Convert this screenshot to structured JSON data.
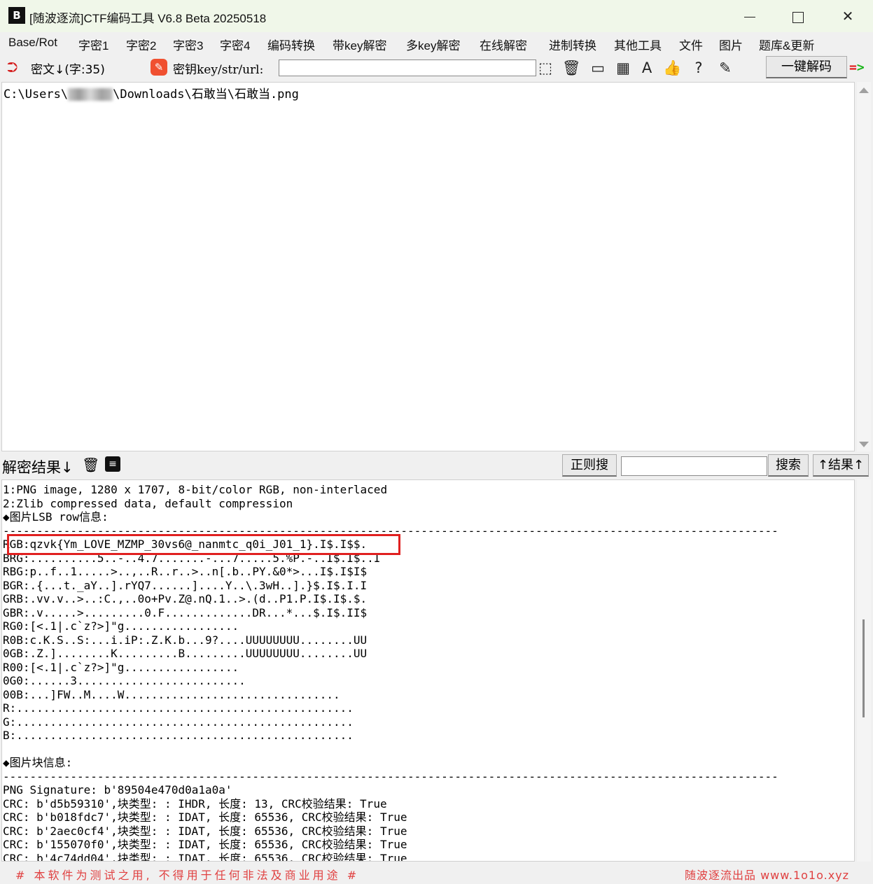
{
  "window": {
    "logo": "B",
    "title": "[随波逐流]CTF编码工具 V6.8 Beta 20250518"
  },
  "menu": [
    "Base/Rot",
    "字密1",
    "字密2",
    "字密3",
    "字密4",
    "编码转换",
    "带key解密",
    "多key解密",
    "在线解密",
    "进制转换",
    "其他工具",
    "文件",
    "图片",
    "题库&更新"
  ],
  "toolbar": {
    "cipher_label": "密文↓(字:35)",
    "key_label": "密钥key/str/url:",
    "key_value": "",
    "decode_button": "一键解码",
    "arrow_left": "=",
    "arrow_right": ">"
  },
  "input": {
    "path_prefix": "C:\\Users\\",
    "path_suffix": "\\Downloads\\石敢当\\石敢当.png"
  },
  "result": {
    "label": "解密结果↓",
    "regex_button": "正则搜",
    "search_value": "",
    "search_button": "搜索",
    "result_up_button": "↑结果↑"
  },
  "output_lines": [
    "1:PNG image, 1280 x 1707, 8-bit/color RGB, non-interlaced",
    "2:Zlib compressed data, default compression",
    "◆图片LSB row信息:",
    "-------------------------------------------------------------------------------------------------------------------",
    "RGB:qzvk{Ym_LOVE_MZMP_30vs6@_nanmtc_q0i_J01_1}.I$.I$$.",
    "BRG:..........5..-..4.7.......-...7.....5.%P.-..I$.I$..I",
    "RBG:p..f..1.....>..,..R..r..>..n[.b..PY.&0*>...I$.I$I$",
    "BGR:.{...t._aY..].rYQ7......]....Y..\\.3wH..].}$.I$.I.I",
    "GRB:.vv.v..>..:C.,..0o+Pv.Z@.nQ.1..>.(d..P1.P.I$.I$.$.",
    "GBR:.v.....>.........0.F.............DR...*...$.I$.II$",
    "RG0:[<.1|.c`z?>]\"g.................",
    "R0B:c.K.S..S:...i.iP:.Z.K.b...9?....UUUUUUUU........UU",
    "0GB:.Z.]........K.........B.........UUUUUUUU........UU",
    "R00:[<.1|.c`z?>]\"g.................",
    "0G0:......3.........................",
    "00B:...]FW..M....W................................",
    "R:..................................................",
    "G:..................................................",
    "B:..................................................",
    "",
    "◆图片块信息:",
    "-------------------------------------------------------------------------------------------------------------------",
    "PNG Signature: b'89504e470d0a1a0a'",
    "CRC: b'd5b59310',块类型: : IHDR, 长度: 13, CRC校验结果: True",
    "CRC: b'b018fdc7',块类型: : IDAT, 长度: 65536, CRC校验结果: True",
    "CRC: b'2aec0cf4',块类型: : IDAT, 长度: 65536, CRC校验结果: True",
    "CRC: b'155070f0',块类型: : IDAT, 长度: 65536, CRC校验结果: True",
    "CRC: b'4c74dd04',块类型: : IDAT, 长度: 65536, CRC校验结果: True"
  ],
  "footer": {
    "left": "# 本软件为测试之用, 不得用于任何非法及商业用途 #",
    "right": "随波逐流出品 www.1o1o.xyz"
  },
  "colors": {
    "highlight": "#e02020",
    "footer_text": "#e04040",
    "title_bg": "#f0f7e9"
  }
}
